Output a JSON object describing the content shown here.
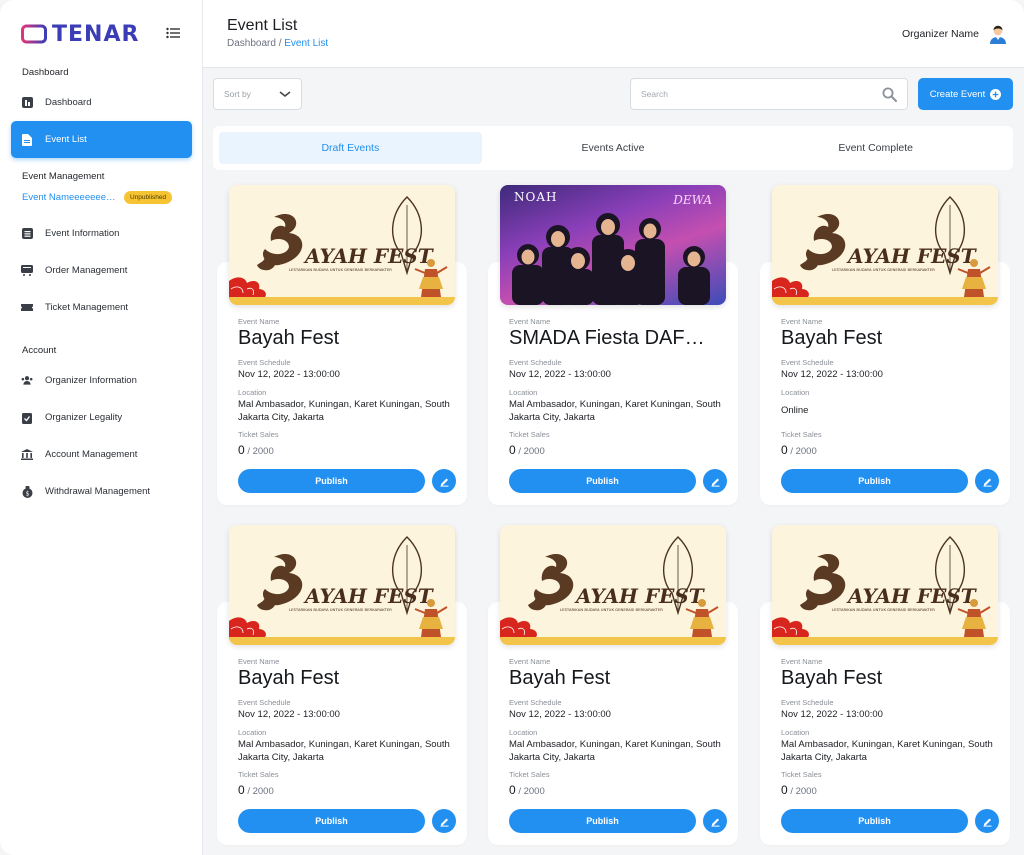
{
  "app": {
    "name": "TENAR"
  },
  "sidebar": {
    "sections": {
      "dashboard": "Dashboard",
      "event_management": "Event Management",
      "account": "Account"
    },
    "items": {
      "dashboard": "Dashboard",
      "event_list": "Event List",
      "event_information": "Event Information",
      "order_management": "Order Management",
      "ticket_management": "Ticket Management",
      "organizer_information": "Organizer Information",
      "organizer_legality": "Organizer Legality",
      "account_management": "Account Management",
      "withdrawal_management": "Withdrawal Management"
    },
    "current_event": {
      "name": "Event Nameeeeeeeeeeee",
      "status": "Unpublished"
    }
  },
  "header": {
    "title": "Event List",
    "breadcrumb_root": "Dashboard",
    "breadcrumb_sep": " / ",
    "breadcrumb_current": "Event List",
    "organizer": "Organizer Name"
  },
  "toolbar": {
    "sort_label": "Sort by",
    "search_placeholder": "Search",
    "create_label": "Create Event"
  },
  "tabs": [
    "Draft Events",
    "Events Active",
    "Event Complete"
  ],
  "labels": {
    "event_name": "Event Name",
    "schedule": "Event Schedule",
    "location": "Location",
    "ticket_sales": "Ticket Sales",
    "publish": "Publish"
  },
  "poster": {
    "brand_title": "Bayah Fest",
    "brand_tagline": "LESTARIKAN BUDAYA UNTUK GENERASI BERKARAKTER",
    "concert_a": "NOAH",
    "concert_b": "DEWA"
  },
  "events": [
    {
      "name": "Bayah Fest",
      "schedule": "Nov 12, 2022 - 13:00:00",
      "location": "Mal Ambasador, Kuningan, Karet Kuningan, South Jakarta City, Jakarta",
      "sold": "0",
      "total": "/ 2000"
    },
    {
      "name": "SMADA Fiesta DAF…",
      "schedule": "Nov 12, 2022 - 13:00:00",
      "location": "Mal Ambasador, Kuningan, Karet Kuningan, South Jakarta City, Jakarta",
      "sold": "0",
      "total": "/ 2000"
    },
    {
      "name": "Bayah Fest",
      "schedule": "Nov 12, 2022 - 13:00:00",
      "location": "Online",
      "sold": "0",
      "total": "/ 2000"
    },
    {
      "name": "Bayah Fest",
      "schedule": "Nov 12, 2022 - 13:00:00",
      "location": "Mal Ambasador, Kuningan, Karet Kuningan, South Jakarta City, Jakarta",
      "sold": "0",
      "total": "/ 2000"
    },
    {
      "name": "Bayah Fest",
      "schedule": "Nov 12, 2022 - 13:00:00",
      "location": "Mal Ambasador, Kuningan, Karet Kuningan, South Jakarta City, Jakarta",
      "sold": "0",
      "total": "/ 2000"
    },
    {
      "name": "Bayah Fest",
      "schedule": "Nov 12, 2022 - 13:00:00",
      "location": "Mal Ambasador, Kuningan, Karet Kuningan, South Jakarta City, Jakarta",
      "sold": "0",
      "total": "/ 2000"
    }
  ],
  "colors": {
    "primary": "#2290f0",
    "badge": "#f6c433",
    "brand": "#3a3db5"
  }
}
